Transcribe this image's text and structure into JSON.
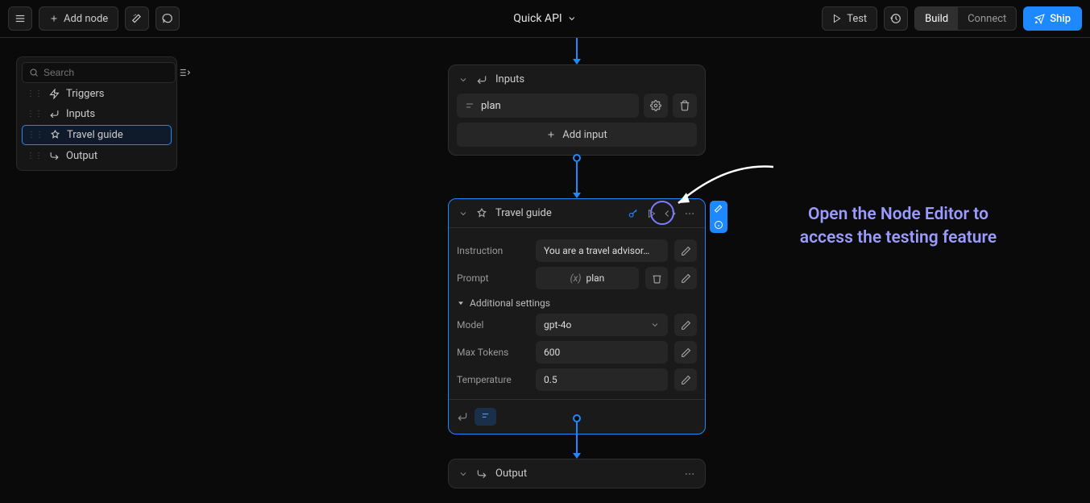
{
  "header": {
    "add_node": "Add node",
    "title": "Quick API",
    "test": "Test",
    "build": "Build",
    "connect": "Connect",
    "ship": "Ship"
  },
  "tree": {
    "search_placeholder": "Search",
    "items": [
      {
        "label": "Triggers"
      },
      {
        "label": "Inputs"
      },
      {
        "label": "Travel guide"
      },
      {
        "label": "Output"
      }
    ]
  },
  "inputs_node": {
    "title": "Inputs",
    "input_name": "plan",
    "add_input": "Add input"
  },
  "travel_node": {
    "title": "Travel guide",
    "instruction_label": "Instruction",
    "instruction_value": "You are a travel advisor…",
    "prompt_label": "Prompt",
    "prompt_var": "plan",
    "additional_label": "Additional settings",
    "model_label": "Model",
    "model_value": "gpt-4o",
    "max_tokens_label": "Max Tokens",
    "max_tokens_value": "600",
    "temperature_label": "Temperature",
    "temperature_value": "0.5"
  },
  "output_node": {
    "title": "Output"
  },
  "callout": {
    "line1": "Open the Node Editor to",
    "line2": "access the testing feature"
  }
}
